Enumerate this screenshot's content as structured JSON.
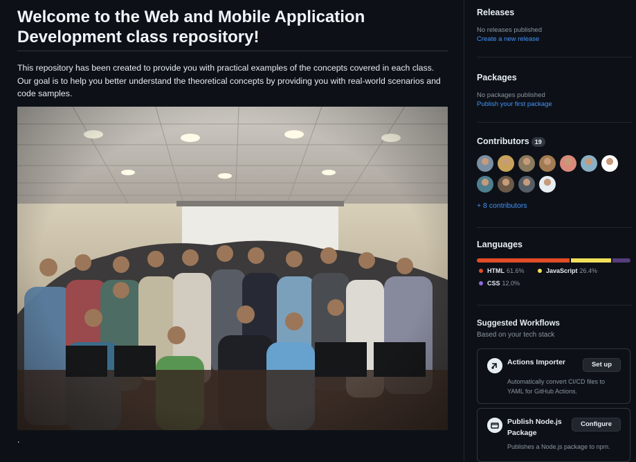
{
  "readme": {
    "heading": "Welcome to the Web and Mobile Application Development class repository!",
    "intro": "This repository has been created to provide you with practical examples of the concepts covered in each class. Our goal is to help you better understand the theoretical concepts by providing you with real-world scenarios and code samples.",
    "trailing_text": "."
  },
  "sidebar": {
    "releases": {
      "title": "Releases",
      "empty_text": "No releases published",
      "link": "Create a new release"
    },
    "packages": {
      "title": "Packages",
      "empty_text": "No packages published",
      "link": "Publish your first package"
    },
    "contributors": {
      "title": "Contributors",
      "count": "19",
      "more_link": "+ 8 contributors",
      "avatar_colors": [
        "#7a8fa3",
        "#c9a25a",
        "#8a7a5e",
        "#a37b52",
        "#d98a7a",
        "#8ab0c4",
        "#ffffff",
        "#4f7f8f",
        "#6b5a48",
        "#555e66",
        "#e6edf3"
      ]
    },
    "languages": {
      "title": "Languages",
      "items": [
        {
          "name": "HTML",
          "percent": "61.6%",
          "value": 61.6,
          "color": "#e34c26"
        },
        {
          "name": "JavaScript",
          "percent": "26.4%",
          "value": 26.4,
          "color": "#f1e05a"
        },
        {
          "name": "CSS",
          "percent": "12.0%",
          "value": 12.0,
          "color": "#563d7c"
        }
      ]
    },
    "workflows": {
      "title": "Suggested Workflows",
      "subtitle": "Based on your tech stack",
      "cards": [
        {
          "title": "Actions Importer",
          "description": "Automatically convert CI/CD files to YAML for GitHub Actions.",
          "button": "Set up",
          "icon": "importer-icon"
        },
        {
          "title": "Publish Node.js Package",
          "description": "Publishes a Node.js package to npm.",
          "button": "Configure",
          "icon": "package-icon"
        }
      ]
    }
  }
}
